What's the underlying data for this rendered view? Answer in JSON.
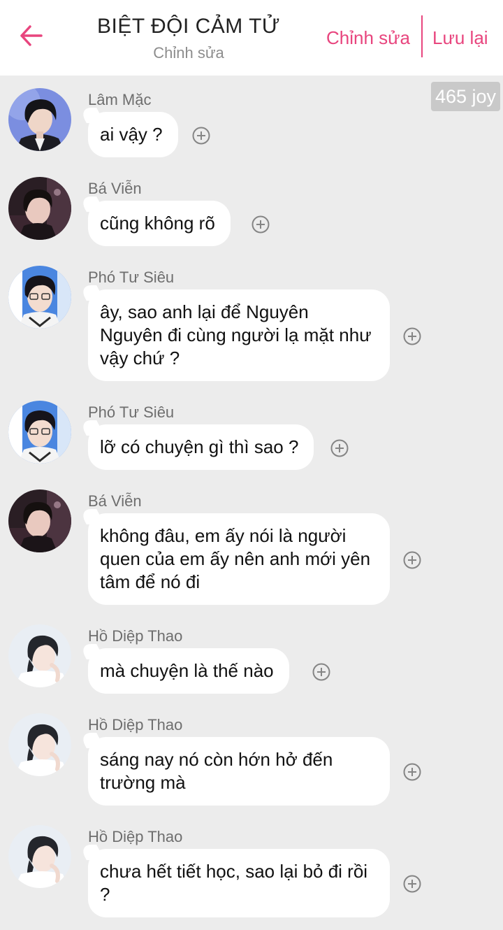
{
  "header": {
    "title": "BIỆT ĐỘI CẢM TỬ",
    "subtitle": "Chỉnh sửa",
    "edit_label": "Chỉnh sửa",
    "save_label": "Lưu lại",
    "back_icon": "arrow-left-icon",
    "accent_color": "#e8457e"
  },
  "badge": {
    "text": "465 joy"
  },
  "messages": [
    {
      "sender": "Lâm Mặc",
      "text": "ai vậy ?",
      "avatar": "avatar-lam-mac"
    },
    {
      "sender": "Bá Viễn",
      "text": "cũng không rõ",
      "avatar": "avatar-ba-vien"
    },
    {
      "sender": "Phó Tư Siêu",
      "text": "ây, sao anh lại để Nguyên Nguyên đi cùng người lạ mặt như vậy chứ ?",
      "avatar": "avatar-pho-tu-sieu"
    },
    {
      "sender": "Phó Tư Siêu",
      "text": "lỡ có chuyện gì thì sao ?",
      "avatar": "avatar-pho-tu-sieu"
    },
    {
      "sender": "Bá Viễn",
      "text": "không đâu, em ấy nói là người quen của em ấy nên anh mới yên tâm để nó đi",
      "avatar": "avatar-ba-vien"
    },
    {
      "sender": "Hồ Diệp Thao",
      "text": "mà chuyện là thế nào",
      "avatar": "avatar-ho-diep-thao"
    },
    {
      "sender": "Hồ Diệp Thao",
      "text": "sáng nay nó còn hớn hở đến trường mà",
      "avatar": "avatar-ho-diep-thao"
    },
    {
      "sender": "Hồ Diệp Thao",
      "text": "chưa hết tiết học, sao lại bỏ đi rồi ?",
      "avatar": "avatar-ho-diep-thao"
    }
  ]
}
